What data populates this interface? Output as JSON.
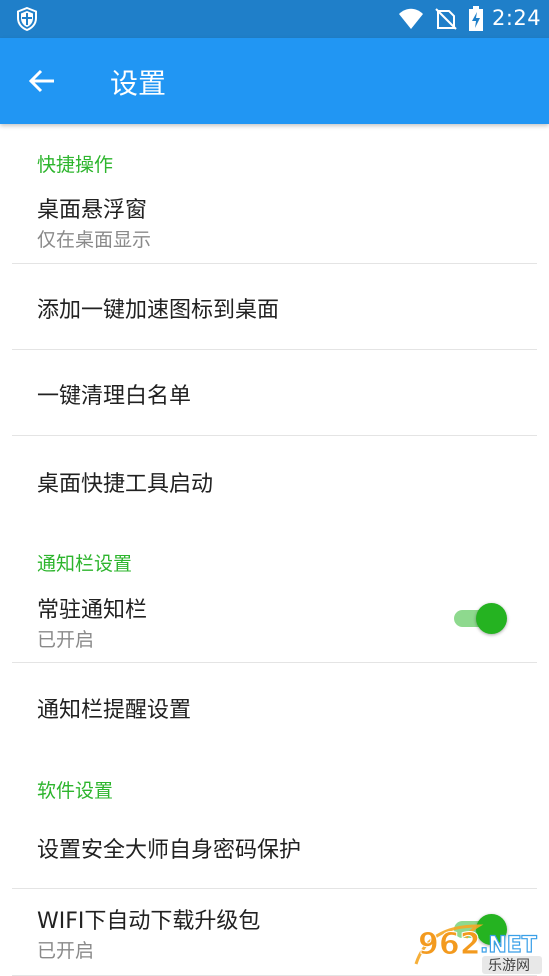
{
  "status_bar": {
    "time": "2:24",
    "icons": [
      "shield-icon",
      "wifi-icon",
      "no-sim-icon",
      "battery-charging-icon"
    ]
  },
  "app_bar": {
    "back_icon": "arrow-left-icon",
    "title": "设置"
  },
  "sections": {
    "quick": {
      "header": "快捷操作",
      "floating_window": {
        "title": "桌面悬浮窗",
        "subtitle": "仅在桌面显示"
      },
      "add_shortcut": {
        "title": "添加一键加速图标到桌面"
      },
      "whitelist": {
        "title": "一键清理白名单"
      },
      "desktop_tools": {
        "title": "桌面快捷工具启动"
      }
    },
    "notification": {
      "header": "通知栏设置",
      "persistent": {
        "title": "常驻通知栏",
        "subtitle": "已开启",
        "enabled": true
      },
      "reminder": {
        "title": "通知栏提醒设置"
      }
    },
    "software": {
      "header": "软件设置",
      "password": {
        "title": "设置安全大师自身密码保护"
      },
      "wifi_update": {
        "title": "WIFI下自动下载升级包",
        "subtitle": "已开启",
        "enabled": true
      }
    }
  },
  "watermark": {
    "brand": "962.NET",
    "sub": "乐游网"
  },
  "colors": {
    "status_bar": "#1f7fc9",
    "app_bar": "#2196f3",
    "accent_green": "#2db52d",
    "toggle_thumb": "#25b321",
    "toggle_track": "#8ed98e"
  }
}
